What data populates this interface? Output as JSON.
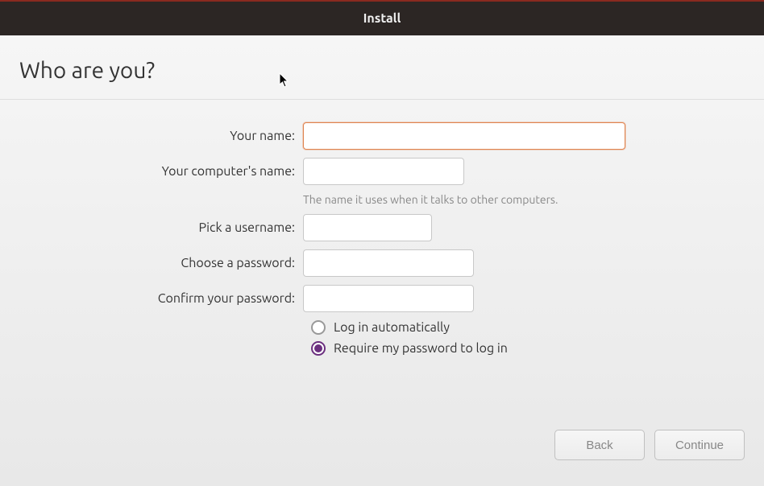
{
  "titlebar": {
    "title": "Install"
  },
  "header": {
    "title": "Who are you?"
  },
  "form": {
    "name_label": "Your name:",
    "name_value": "",
    "computer_label": "Your computer's name:",
    "computer_value": "",
    "computer_hint": "The name it uses when it talks to other computers.",
    "username_label": "Pick a username:",
    "username_value": "",
    "password_label": "Choose a password:",
    "password_value": "",
    "confirm_label": "Confirm your password:",
    "confirm_value": ""
  },
  "login_options": {
    "auto": "Log in automatically",
    "require": "Require my password to log in",
    "selected": "require"
  },
  "buttons": {
    "back": "Back",
    "continue": "Continue"
  }
}
